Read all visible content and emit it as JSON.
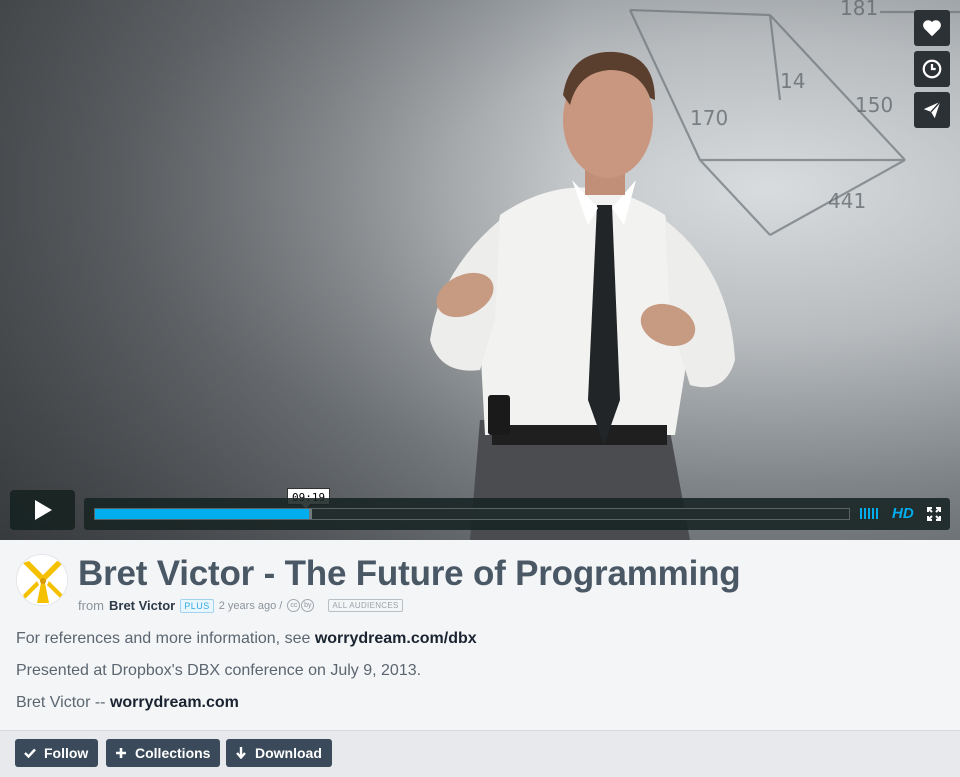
{
  "player": {
    "timecode": "09:19",
    "progress_played": 0.284,
    "progress_loaded": 0.288,
    "hd_label": "HD",
    "board_numbers": [
      "181",
      "14",
      "150",
      "170",
      "441"
    ],
    "side_buttons": [
      {
        "name": "like-button",
        "icon": "heart-icon"
      },
      {
        "name": "watch-later-button",
        "icon": "clock-icon"
      },
      {
        "name": "share-button",
        "icon": "paper-plane-icon"
      }
    ]
  },
  "video": {
    "title": "Bret Victor - The Future of Programming",
    "from_label": "from",
    "author": "Bret Victor",
    "plus_badge": "PLUS",
    "age": "2 years ago /",
    "license_icons": [
      "cc",
      "by"
    ],
    "audience_badge": "ALL AUDIENCES"
  },
  "description": {
    "line1_text": "For references and more information, see ",
    "line1_link": "worrydream.com/dbx",
    "line2_text": "Presented at Dropbox's DBX conference on July 9, 2013.",
    "line3_text": "Bret Victor -- ",
    "line3_link": "worrydream.com"
  },
  "actions": {
    "follow": "Follow",
    "collections": "Collections",
    "download": "Download"
  },
  "colors": {
    "accent": "#00adef",
    "title": "#4a5866",
    "button_bg": "#3a4a5a",
    "avatar_yellow": "#f5c000"
  }
}
